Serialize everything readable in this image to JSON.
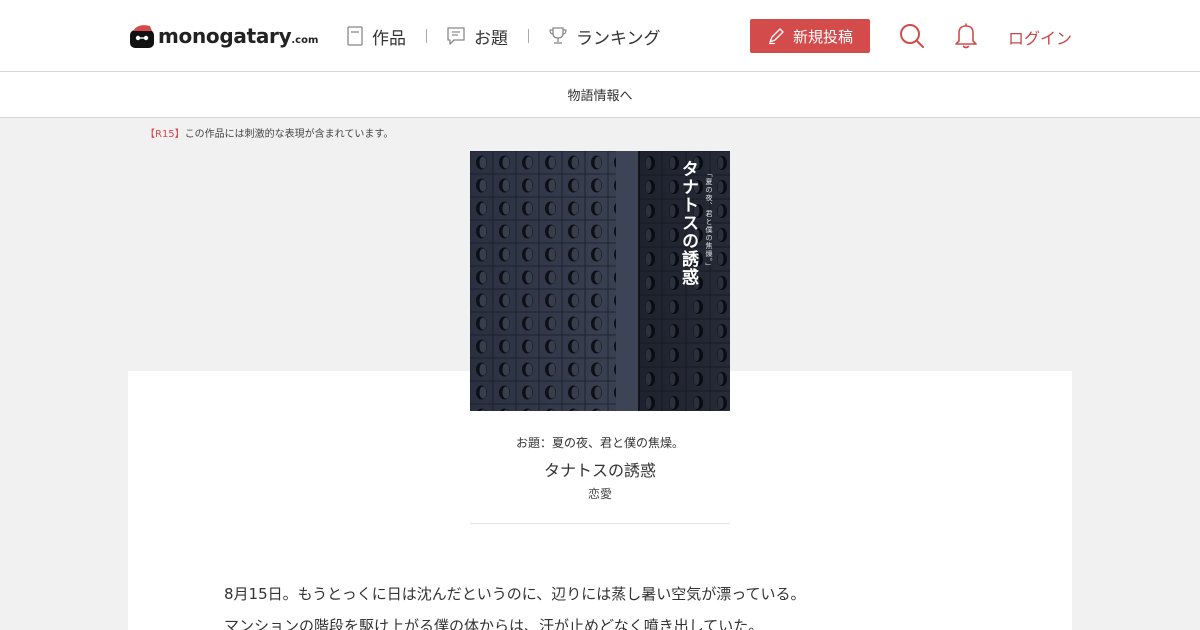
{
  "header": {
    "logo": {
      "name": "monogatary",
      "suffix": ".com"
    },
    "nav": [
      {
        "label": "作品",
        "icon": "book-icon"
      },
      {
        "label": "お題",
        "icon": "message-icon"
      },
      {
        "label": "ランキング",
        "icon": "trophy-icon"
      }
    ],
    "post_button": "新規投稿",
    "login_label": "ログイン"
  },
  "subbar": {
    "link_label": "物語情報へ"
  },
  "notice": {
    "tag": "【R15】",
    "text": "この作品には刺激的な表現が含まれています。"
  },
  "cover": {
    "title": "タナトスの誘惑",
    "subtitle": "「夏の夜、君と僕の焦燥。」"
  },
  "work": {
    "theme": "お題：夏の夜、君と僕の焦燥。",
    "title": "タナトスの誘惑",
    "genre": "恋愛"
  },
  "body": {
    "lines": [
      "8月15日。もうとっくに日は沈んだというのに、辺りには蒸し暑い空気が漂っている。",
      "マンションの階段を駆け上がる僕の体からは、汗が止めどなく噴き出していた。"
    ]
  },
  "colors": {
    "accent": "#d44b4b",
    "background": "#f1f1f1"
  }
}
